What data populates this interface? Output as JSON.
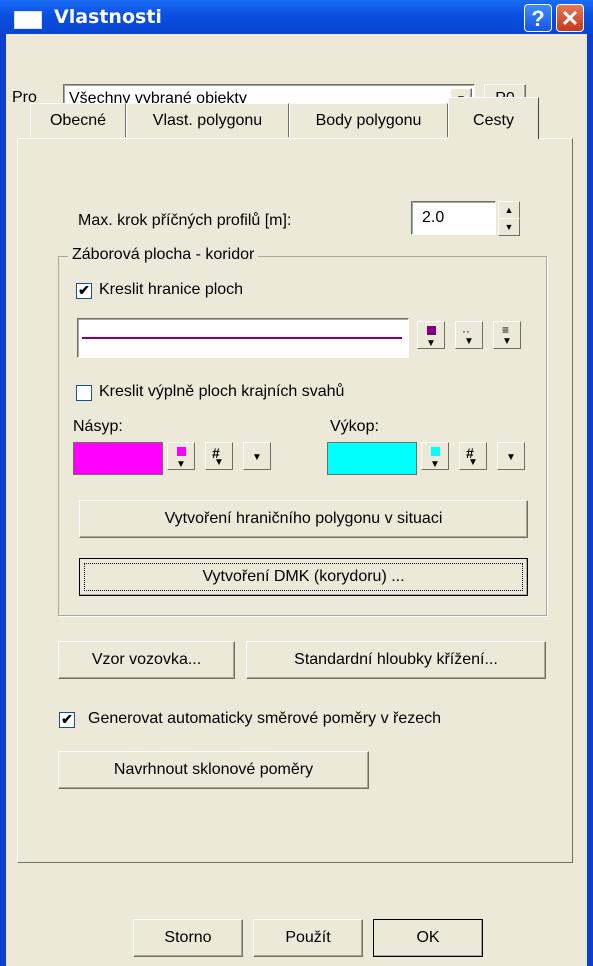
{
  "window": {
    "title": "Vlastnosti",
    "help_glyph": "?",
    "close_glyph": "✕"
  },
  "pro": {
    "label": "Pro",
    "selected": "Všechny vybrané objekty",
    "p0_label": "P0"
  },
  "tabs": [
    {
      "label": "Obecné"
    },
    {
      "label": "Vlast. polygonu"
    },
    {
      "label": "Body polygonu"
    },
    {
      "label": "Cesty"
    }
  ],
  "cesty": {
    "max_krok_label": "Max. krok příčných profilů [m]:",
    "max_krok_value": "2.0",
    "group_title": "Záborová plocha - koridor",
    "kreslit_hranice_label": "Kreslit hranice ploch",
    "kreslit_hranice_checked": true,
    "line_color": "#800080",
    "kreslit_vyplne_label": "Kreslit výplně ploch krajních svahů",
    "kreslit_vyplne_checked": false,
    "nasyp_label": "Násyp:",
    "nasyp_color": "#ff00ff",
    "vykop_label": "Výkop:",
    "vykop_color": "#00ffff",
    "btn_hranicni_polygon": "Vytvoření hraničního polygonu v situaci",
    "btn_dmk": "Vytvoření DMK (korydoru) ...",
    "btn_vzor_vozovka": "Vzor vozovka...",
    "btn_standardni_hloubky": "Standardní hloubky křížení...",
    "generovat_label": "Generovat automaticky směrové poměry v řezech",
    "generovat_checked": true,
    "btn_navrhnout": "Navrhnout sklonové poměry"
  },
  "footer": {
    "storno": "Storno",
    "pouzit": "Použít",
    "ok": "OK"
  }
}
